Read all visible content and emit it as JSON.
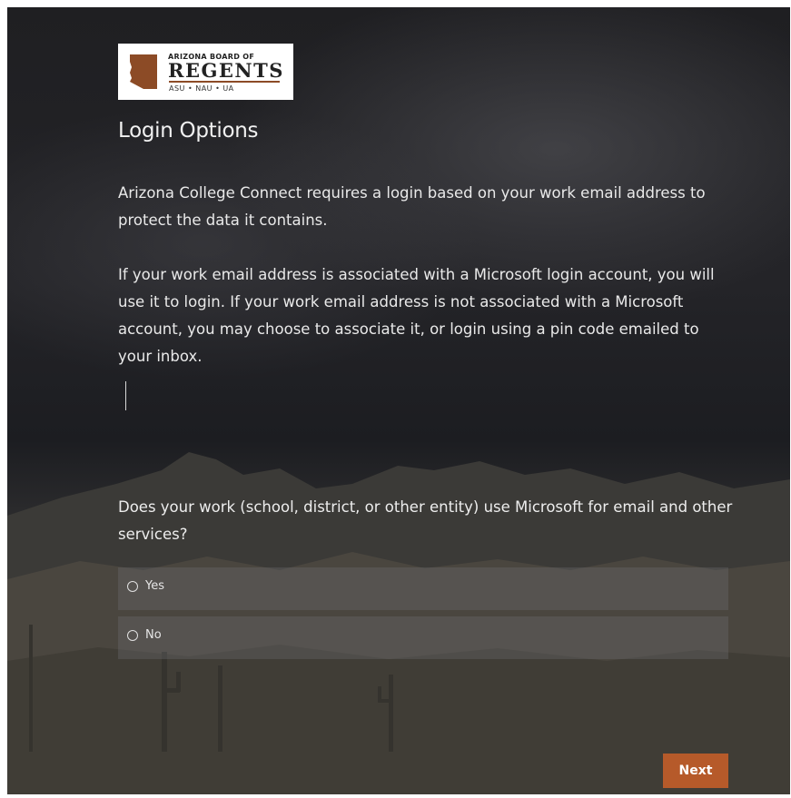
{
  "logo": {
    "org_top": "ARIZONA BOARD OF",
    "org_main": "REGENTS",
    "org_schools": "ASU • NAU • UA",
    "accent_color": "#8c4b26"
  },
  "page": {
    "title": "Login Options",
    "paragraph1": "Arizona College Connect requires a login based on your work email address to protect the data it contains.",
    "paragraph2": "If your work email address is associated with a Microsoft login account, you will use it to login. If your work email address is not associated with a Microsoft account, you may choose to associate it, or login using a pin code emailed to your inbox."
  },
  "question": {
    "text": "Does your work (school, district, or other entity) use Microsoft for email and other services?",
    "options": [
      {
        "label": "Yes",
        "selected": false
      },
      {
        "label": "No",
        "selected": false
      }
    ]
  },
  "actions": {
    "next_label": "Next",
    "next_color": "#b65a2a"
  }
}
